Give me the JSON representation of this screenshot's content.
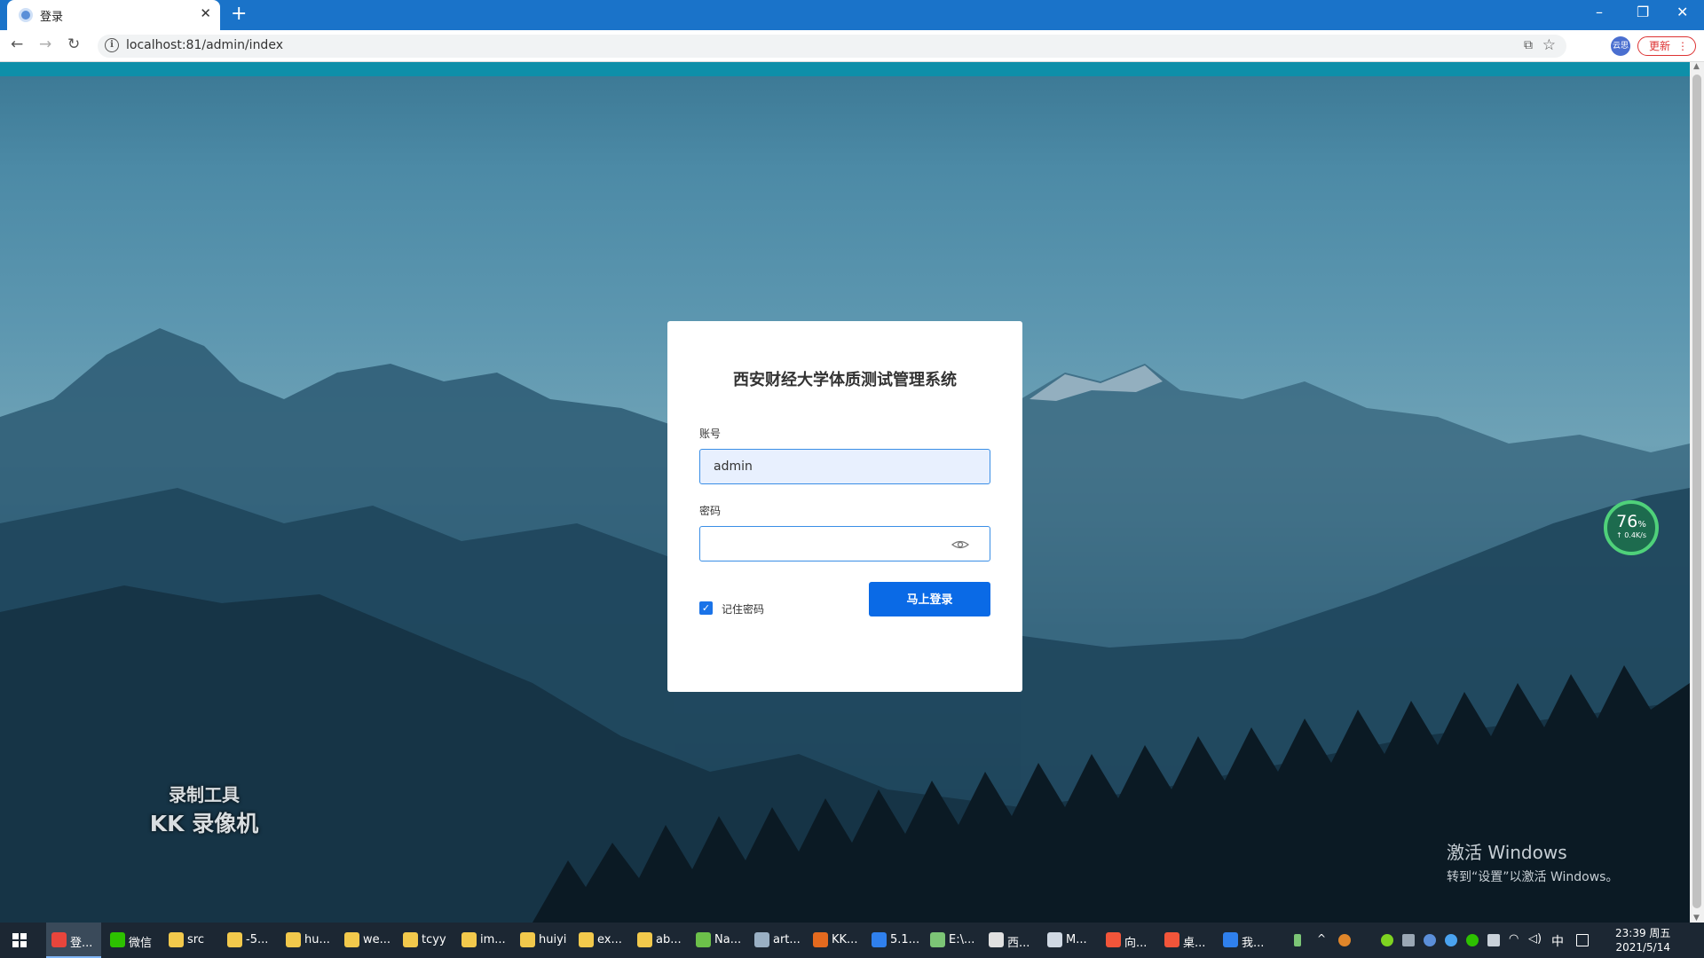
{
  "browser": {
    "tab_title": "登录",
    "tab_close": "✕",
    "new_tab": "+",
    "url": "localhost:81/admin/index",
    "profile_label": "云思",
    "update_label": "更新",
    "menu_glyph": "⋮",
    "window_controls": {
      "minimize": "–",
      "restore": "❐",
      "close": "✕"
    }
  },
  "login": {
    "title": "西安财经大学体质测试管理系统",
    "account_label": "账号",
    "account_value": "admin",
    "password_label": "密码",
    "password_value": "",
    "remember_label": "记住密码",
    "remember_checked": true,
    "submit_label": "马上登录"
  },
  "overlays": {
    "recorder_line1": "录制工具",
    "recorder_line2": "KK 录像机",
    "activate_line1": "激活 Windows",
    "activate_line2": "转到“设置”以激活 Windows。",
    "net_percent": "76",
    "net_percent_unit": "%",
    "net_speed": "↑ 0.4K/s"
  },
  "taskbar": {
    "items": [
      {
        "label": "登...",
        "icon": "chrome-icon",
        "color": "#e8453c"
      },
      {
        "label": "微信",
        "icon": "wechat-icon",
        "color": "#2dc100"
      },
      {
        "label": "src",
        "icon": "folder-icon",
        "color": "#f2c94c"
      },
      {
        "label": "-5...",
        "icon": "folder-icon",
        "color": "#f2c94c"
      },
      {
        "label": "hu...",
        "icon": "folder-icon",
        "color": "#f2c94c"
      },
      {
        "label": "we...",
        "icon": "folder-icon",
        "color": "#f2c94c"
      },
      {
        "label": "tcyy",
        "icon": "folder-icon",
        "color": "#f2c94c"
      },
      {
        "label": "im...",
        "icon": "folder-icon",
        "color": "#f2c94c"
      },
      {
        "label": "huiyi",
        "icon": "folder-icon",
        "color": "#f2c94c"
      },
      {
        "label": "ex...",
        "icon": "folder-icon",
        "color": "#f2c94c"
      },
      {
        "label": "ab...",
        "icon": "folder-icon",
        "color": "#f2c94c"
      },
      {
        "label": "Na...",
        "icon": "navicat-icon",
        "color": "#6cc04a"
      },
      {
        "label": "art...",
        "icon": "app-icon",
        "color": "#9ab0c4"
      },
      {
        "label": "KK...",
        "icon": "kk-recorder-icon",
        "color": "#e46a1f"
      },
      {
        "label": "5.1...",
        "icon": "vscode-icon",
        "color": "#2f80ed"
      },
      {
        "label": "E:\\...",
        "icon": "notepad-icon",
        "color": "#7cc576"
      },
      {
        "label": "西...",
        "icon": "chat-icon",
        "color": "#e0e0e0"
      },
      {
        "label": "M...",
        "icon": "pen-icon",
        "color": "#cfd8e3"
      },
      {
        "label": "向...",
        "icon": "slides-icon",
        "color": "#f2553a"
      },
      {
        "label": "桌...",
        "icon": "slides-icon",
        "color": "#f2553a"
      },
      {
        "label": "我...",
        "icon": "phone-icon",
        "color": "#2f80ed"
      }
    ],
    "ime_label": "中",
    "clock_time": "23:39 周五",
    "clock_date": "2021/5/14"
  }
}
